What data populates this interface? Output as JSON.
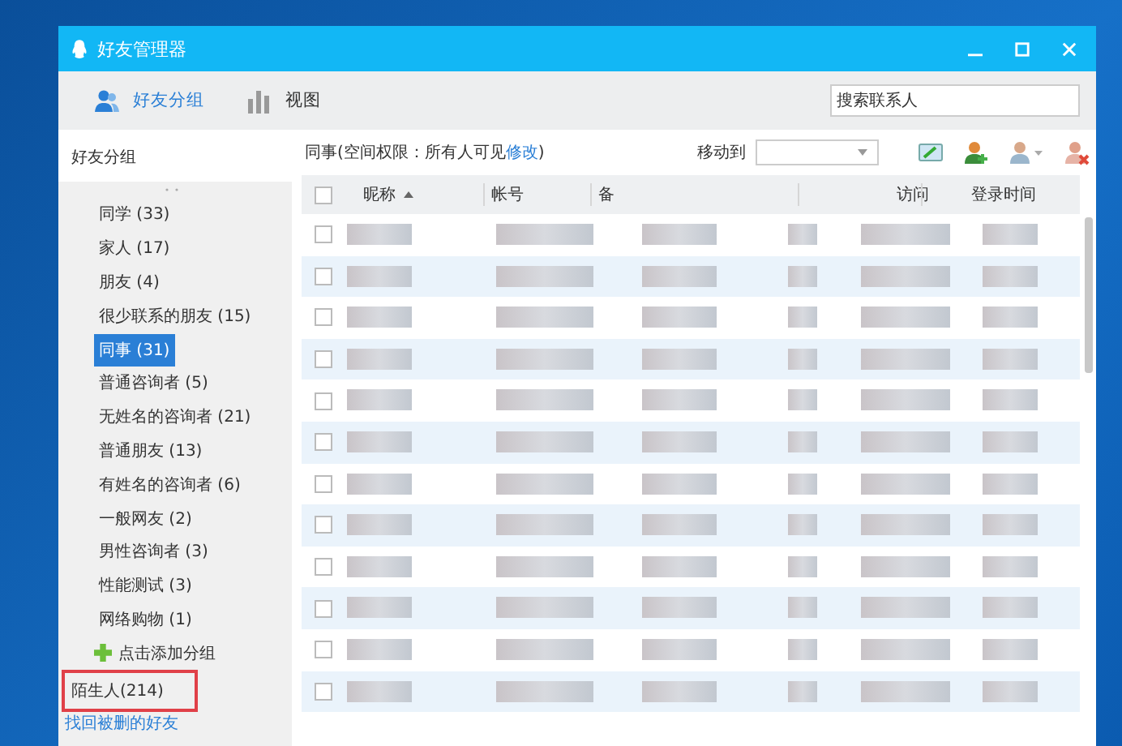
{
  "window": {
    "title": "好友管理器"
  },
  "toolbar": {
    "tabs": [
      {
        "label": "好友分组",
        "selected": true,
        "kind": "friends"
      },
      {
        "label": "视图",
        "selected": false,
        "kind": "chart"
      }
    ],
    "search": {
      "placeholder": "搜索联系人"
    }
  },
  "sidebar": {
    "heading": "好友分组",
    "groups": [
      {
        "label": "同学 (33)",
        "selected": false
      },
      {
        "label": "家人 (17)",
        "selected": false
      },
      {
        "label": "朋友 (4)",
        "selected": false
      },
      {
        "label": "很少联系的朋友 (15)",
        "selected": false
      },
      {
        "label": "同事 (31)",
        "selected": true
      },
      {
        "label": "普通咨询者 (5)",
        "selected": false
      },
      {
        "label": "无姓名的咨询者 (21)",
        "selected": false
      },
      {
        "label": "普通朋友 (13)",
        "selected": false
      },
      {
        "label": "有姓名的咨询者 (6)",
        "selected": false
      },
      {
        "label": "一般网友 (2)",
        "selected": false
      },
      {
        "label": "男性咨询者 (3)",
        "selected": false
      },
      {
        "label": "性能测试 (3)",
        "selected": false
      },
      {
        "label": "网络购物 (1)",
        "selected": false
      }
    ],
    "add_group": "点击添加分组",
    "strangers": {
      "label": "陌生人(214)",
      "highlighted": true
    },
    "recover_link": "找回被删的好友"
  },
  "content": {
    "permission": {
      "text": "同事(空间权限：所有人可见",
      "link": "修改",
      "suffix": ")"
    },
    "move_to": {
      "label": "移动到"
    },
    "table": {
      "select_all": {
        "checked": false
      },
      "columns": [
        {
          "label": "昵称",
          "sorted": true
        },
        {
          "label": "帐号",
          "sorted": false
        },
        {
          "label": "备",
          "sorted": false
        },
        {
          "label": "访问",
          "sorted": false
        },
        {
          "label": "登录时间",
          "sorted": false
        }
      ],
      "rows": [
        {
          "checked": false
        },
        {
          "checked": false
        },
        {
          "checked": false
        },
        {
          "checked": false
        },
        {
          "checked": false
        },
        {
          "checked": false
        },
        {
          "checked": false
        },
        {
          "checked": false
        },
        {
          "checked": false
        },
        {
          "checked": false
        },
        {
          "checked": false
        },
        {
          "checked": false
        }
      ]
    }
  }
}
